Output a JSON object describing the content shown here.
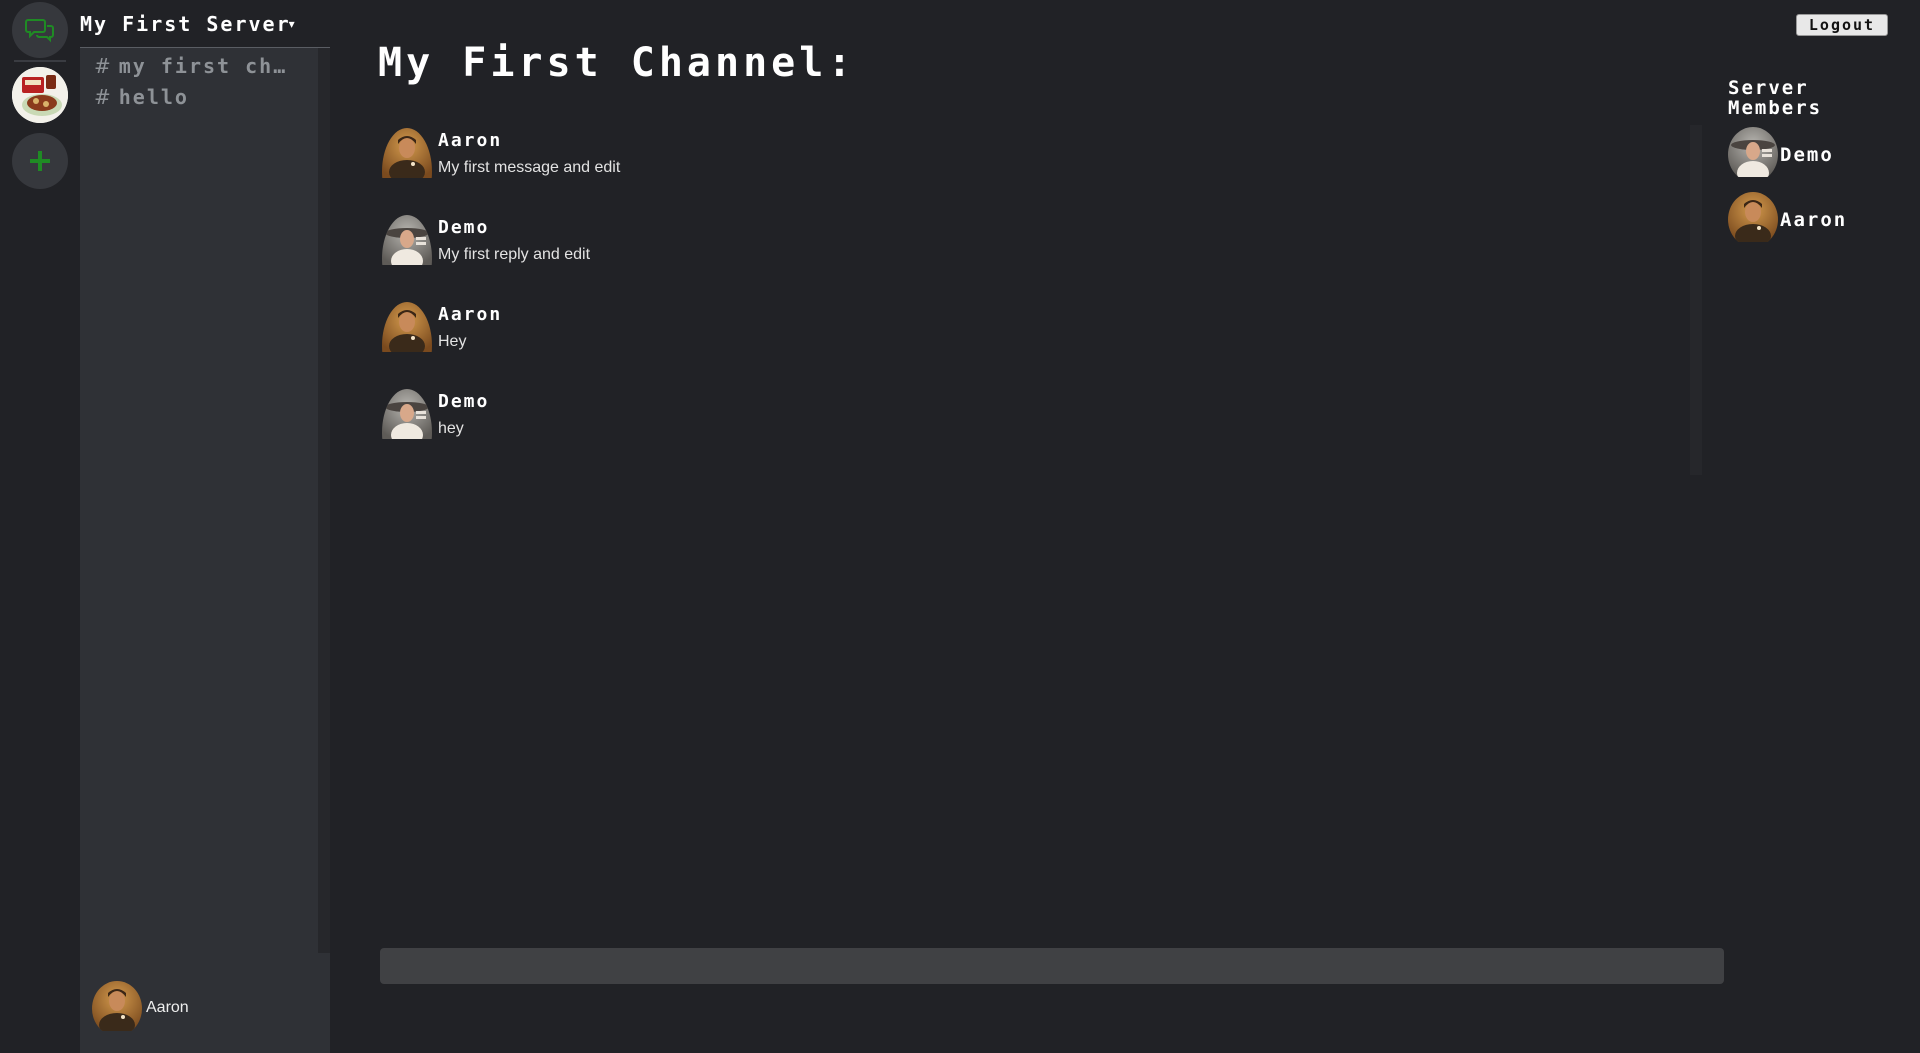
{
  "server": {
    "name": "My First Server"
  },
  "channels": [
    {
      "label": "my first ch..."
    },
    {
      "label": "hello"
    }
  ],
  "current_user": {
    "name": "Aaron"
  },
  "channel_title": "My First Channel:",
  "messages": [
    {
      "author": "Aaron",
      "text": "My first message and edit"
    },
    {
      "author": "Demo",
      "text": "My first reply and edit"
    },
    {
      "author": "Aaron",
      "text": "Hey"
    },
    {
      "author": "Demo",
      "text": "hey"
    }
  ],
  "members": {
    "title": "Server Members",
    "list": [
      {
        "name": "Demo"
      },
      {
        "name": "Aaron"
      }
    ]
  },
  "logout_label": "Logout",
  "composer": {
    "value": "",
    "placeholder": ""
  },
  "icons": {
    "home": "chat-bubbles-icon",
    "add": "plus-icon",
    "channel": "hash-icon"
  },
  "colors": {
    "accent": "#1f8b24",
    "background": "#212226",
    "sidebar": "#2f3136"
  }
}
